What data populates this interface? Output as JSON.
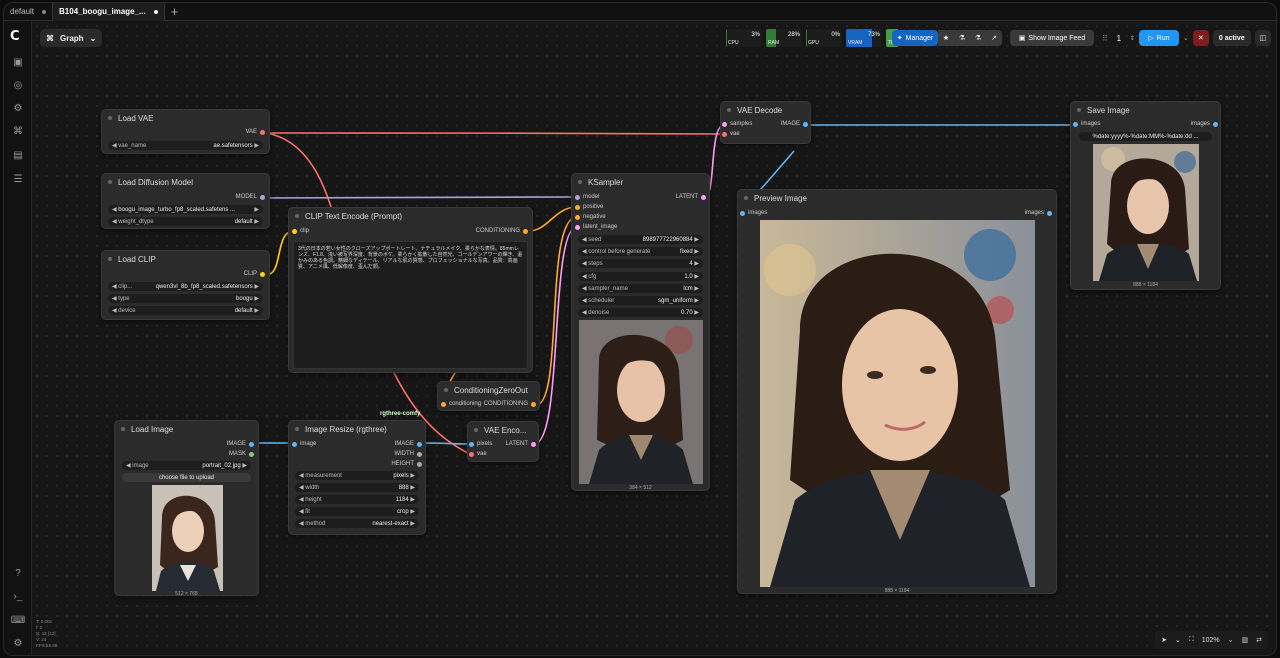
{
  "tabs": [
    {
      "label": "default"
    },
    {
      "label": "B104_boogu_image_..."
    }
  ],
  "toolbar": {
    "graph_label": "Graph",
    "stats": [
      {
        "label": "CPU",
        "value": "3%",
        "color": "#2e7d32",
        "pct": 0.03
      },
      {
        "label": "RAM",
        "value": "28%",
        "color": "#2e7d32",
        "pct": 0.28
      },
      {
        "label": "GPU",
        "value": "0%",
        "color": "#2e7d32",
        "pct": 0.0
      },
      {
        "label": "VRAM",
        "value": "73%",
        "color": "#1565c0",
        "pct": 0.73
      },
      {
        "label": "TEMP",
        "value": "34°",
        "color": "#43a047",
        "pct": 0.34
      }
    ],
    "manager_label": "Manager",
    "image_feed_label": "Show Image Feed",
    "queue_count": "1",
    "run_label": "Run",
    "active_label": "0 active"
  },
  "nodes": {
    "load_vae": {
      "title": "Load VAE",
      "output": "VAE",
      "widget_label": "vae_name",
      "widget_value": "ae.safetensors"
    },
    "load_diffusion": {
      "title": "Load Diffusion Model",
      "output": "MODEL",
      "w1_value": "boogu_image_turbo_fp8_scaled.safetens ...",
      "w2_label": "weight_dtype",
      "w2_value": "default"
    },
    "load_clip": {
      "title": "Load CLIP",
      "output": "CLIP",
      "w1_label": "clip...",
      "w1_value": "qwen3vl_8b_fp8_scaled.safetensors",
      "w2_label": "type",
      "w2_value": "boogu",
      "w3_label": "device",
      "w3_value": "default"
    },
    "clip_text": {
      "title": "CLIP Text Encode (Prompt)",
      "input": "clip",
      "output": "CONDITIONING",
      "text": "3代の日本の若い女性のクローズアップポートレート、ナチュラルメイク、柔らかな表情。85mmレンズ、F1.8、浅い被写界深度、背景のボケ。柔らかく拡散した自然光、ゴールデンアワーの輝き、温かみのある色調。精細なディテール、リアルな肌の質感、プロフェッショナルな写真。品質：高画質、アニメ風、低解像度、歪んだ顔。"
    },
    "cond_zero": {
      "title": "ConditioningZeroOut",
      "input": "conditioning",
      "output": "CONDITIONING"
    },
    "ksampler": {
      "title": "KSampler",
      "inputs": [
        "model",
        "positive",
        "negative",
        "latent_image"
      ],
      "output": "LATENT",
      "widgets": [
        {
          "label": "seed",
          "value": "898977722960884"
        },
        {
          "label": "control before generate",
          "value": "fixed"
        },
        {
          "label": "steps",
          "value": "4"
        },
        {
          "label": "cfg",
          "value": "1.0"
        },
        {
          "label": "sampler_name",
          "value": "lcm"
        },
        {
          "label": "scheduler",
          "value": "sgm_uniform"
        },
        {
          "label": "denoise",
          "value": "0.70"
        }
      ],
      "caption": "384 × 512"
    },
    "vae_decode": {
      "title": "VAE Decode",
      "inputs": [
        "samples",
        "vae"
      ],
      "output": "IMAGE"
    },
    "save_image": {
      "title": "Save Image",
      "input": "images",
      "output": "images",
      "widget_value": "%date:yyyy%-%date:MM%-%date:dd ...",
      "caption": "888 × 1184"
    },
    "preview": {
      "title": "Preview Image",
      "input": "images",
      "output": "images",
      "caption": "888 × 1184"
    },
    "load_image": {
      "title": "Load Image",
      "out1": "IMAGE",
      "out2": "MASK",
      "w_label": "image",
      "w_value": "portrait_02.jpg",
      "upload_label": "choose file to upload",
      "caption": "512 × 768"
    },
    "image_resize": {
      "title": "Image Resize (rgthree)",
      "group": "rgthree-comfy",
      "input": "image",
      "outputs": [
        "IMAGE",
        "WIDTH",
        "HEIGHT"
      ],
      "widgets": [
        {
          "label": "measurement",
          "value": "pixels"
        },
        {
          "label": "width",
          "value": "888"
        },
        {
          "label": "height",
          "value": "1184"
        },
        {
          "label": "fit",
          "value": "crop"
        },
        {
          "label": "method",
          "value": "nearest-exact"
        }
      ]
    },
    "vae_encode": {
      "title": "VAE Enco...",
      "inputs": [
        "pixels",
        "vae"
      ],
      "output": "LATENT"
    }
  },
  "perf": {
    "lines": [
      "T: 0.00s",
      "I: 0",
      "N: 12 [12]",
      "V: 24",
      "FPS:59.88"
    ]
  },
  "zoom": "102%",
  "colors": {
    "vae": "#ff6e6e",
    "model": "#b39ddb",
    "clip": "#ffd500",
    "conditioning": "#ffa931",
    "latent": "#ff9cf9",
    "image": "#64b5f6",
    "mask": "#81c784"
  }
}
